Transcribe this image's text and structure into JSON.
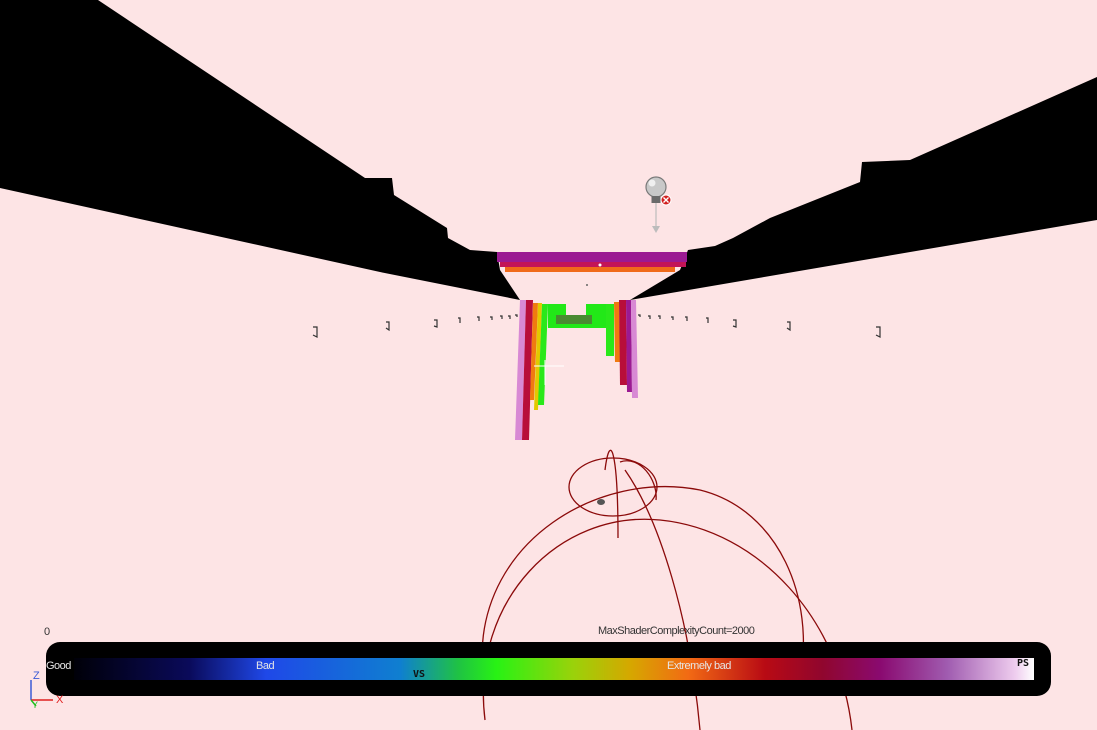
{
  "hud": {
    "min_label": "0",
    "max_label": "MaxShaderComplexityCount=2000"
  },
  "legend": {
    "good_label": "Good",
    "bad_label": "Bad",
    "extremely_bad_label": "Extremely bad",
    "vs_marker": "VS",
    "ps_marker": "PS"
  },
  "axis_gizmo": {
    "z_label": "Z",
    "x_label": "X",
    "y_label": "Y",
    "z_color": "#3b5bd6",
    "x_color": "#e02020",
    "y_color": "#20c020"
  },
  "scene": {
    "view_mode": "Shader Complexity",
    "background_color": "#fde4e5",
    "wireframe_color": "#8b0000",
    "icons": [
      "point-light-icon",
      "error-badge-icon"
    ]
  }
}
